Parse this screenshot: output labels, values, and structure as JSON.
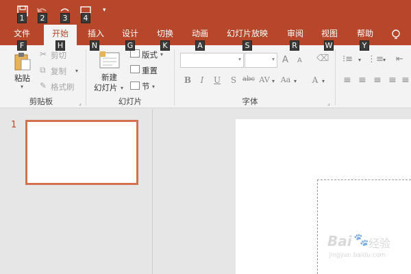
{
  "qat": {
    "keytips": [
      "1",
      "2",
      "3",
      "4"
    ]
  },
  "tabs": [
    {
      "label": "文件",
      "keytip": "F"
    },
    {
      "label": "开始",
      "keytip": "H"
    },
    {
      "label": "插入",
      "keytip": "N"
    },
    {
      "label": "设计",
      "keytip": "G"
    },
    {
      "label": "切换",
      "keytip": "K"
    },
    {
      "label": "动画",
      "keytip": "A"
    },
    {
      "label": "幻灯片放映",
      "keytip": "S"
    },
    {
      "label": "审阅",
      "keytip": "R"
    },
    {
      "label": "视图",
      "keytip": "W"
    },
    {
      "label": "帮助",
      "keytip": "Y"
    }
  ],
  "ribbon": {
    "clipboard": {
      "paste": "粘贴",
      "cut": "剪切",
      "copy": "复制",
      "format_painter": "格式刷",
      "group": "剪贴板"
    },
    "slides": {
      "new_slide_1": "新建",
      "new_slide_2": "幻灯片",
      "layout": "版式",
      "reset": "重置",
      "section": "节",
      "group": "幻灯片"
    },
    "font": {
      "group": "字体",
      "bold": "B",
      "italic": "I",
      "underline": "U",
      "shadow": "S",
      "strike": "abc",
      "spacing": "AV",
      "case": "Aa",
      "color": "A",
      "grow": "A",
      "shrink": "A"
    }
  },
  "slides_pane": {
    "slide_number": "1"
  },
  "watermark": {
    "brand": "Bai",
    "brand2": "经验",
    "url": "jingyan.baidu.com"
  },
  "colors": {
    "accent": "#b7472a",
    "thumb_border": "#d2714f"
  }
}
